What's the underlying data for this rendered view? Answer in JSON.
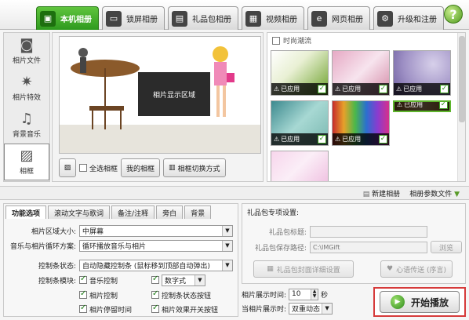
{
  "top_tabs": [
    {
      "label": "本机相册",
      "icon": "photo-album-icon",
      "active": true
    },
    {
      "label": "锁屏相册",
      "icon": "monitor-icon"
    },
    {
      "label": "礼品包相册",
      "icon": "gift-icon"
    },
    {
      "label": "视频相册",
      "icon": "film-icon"
    },
    {
      "label": "网页相册",
      "icon": "web-icon"
    },
    {
      "label": "升级和注册",
      "icon": "upgrade-icon"
    }
  ],
  "help": {
    "label": "?"
  },
  "side_nav": [
    {
      "label": "相片文件",
      "icon": "camera-icon"
    },
    {
      "label": "相片特效",
      "icon": "effects-icon"
    },
    {
      "label": "背景音乐",
      "icon": "music-note-icon"
    },
    {
      "label": "相框",
      "icon": "frame-icon",
      "active": true
    }
  ],
  "preview": {
    "stage_label": "相片显示区域",
    "select_all_label": "全选相框",
    "my_frames_label": "我的相框",
    "switch_mode_label": "相框切换方式"
  },
  "gallery": {
    "title": "时尚潮流",
    "applied_label": "已应用"
  },
  "strip": {
    "new_album": "新建相册",
    "album_param_file": "相册参数文件"
  },
  "settings": {
    "tabs": [
      "功能选项",
      "滚动文字与歌词",
      "备注/注释",
      "旁白",
      "背景"
    ],
    "area_size_label": "相片区域大小:",
    "area_size_value": "中屏幕",
    "loop_label": "音乐与相片循环方案:",
    "loop_value": "循环播放音乐与相片",
    "ctrl_state_label": "控制条状态:",
    "ctrl_state_value": "自动隐藏控制条 (鼠标移到顶部自动弹出)",
    "ctrl_module_label": "控制条模块:",
    "modules": {
      "music_ctrl": "音乐控制",
      "digital": "数字式",
      "photo_ctrl": "相片控制",
      "ctrl_state_btn": "控制条状态按钮",
      "photo_pause": "相片停留时间",
      "effect_switch": "相片效果开关按钮"
    }
  },
  "gift": {
    "title": "礼品包专项设置:",
    "title_label": "礼品包标题:",
    "path_label": "礼品包保存路径:",
    "path_value": "C:\\IMGift",
    "browse": "浏览",
    "cover_btn": "礼品包封面详细设置",
    "wish_btn": "心语传送 (序言)"
  },
  "timing": {
    "display_time_label": "相片展示时间:",
    "display_time_value": "10",
    "seconds_unit": "秒",
    "mode_label": "当相片展示时:",
    "mode_value": "双重动态"
  },
  "start": {
    "label": "开始播放"
  }
}
